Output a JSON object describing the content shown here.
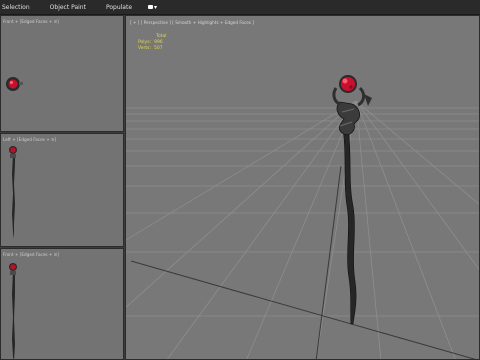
{
  "menu": {
    "items": [
      "Selection",
      "Object Paint",
      "Populate"
    ]
  },
  "viewports": {
    "top": {
      "label": "Front + [Edged Faces + ≡]"
    },
    "left": {
      "label": "Left + [Edged Faces + ≡]"
    },
    "front": {
      "label": "Front + [Edged Faces + ≡]"
    },
    "perspective": {
      "label": "[ + ] [ Perspective ] [ Smooth + Highlights + Edged Faces ]"
    }
  },
  "stats": {
    "header": "Total",
    "polys_label": "Polys:",
    "polys_value": "996",
    "verts_label": "Verts:",
    "verts_value": "507"
  },
  "colors": {
    "viewport_bg": "#787878",
    "grid": "#8c8c8c",
    "staff": "#2b2b2b",
    "gem": "#c8102e",
    "stats_text": "#e8d84a"
  }
}
